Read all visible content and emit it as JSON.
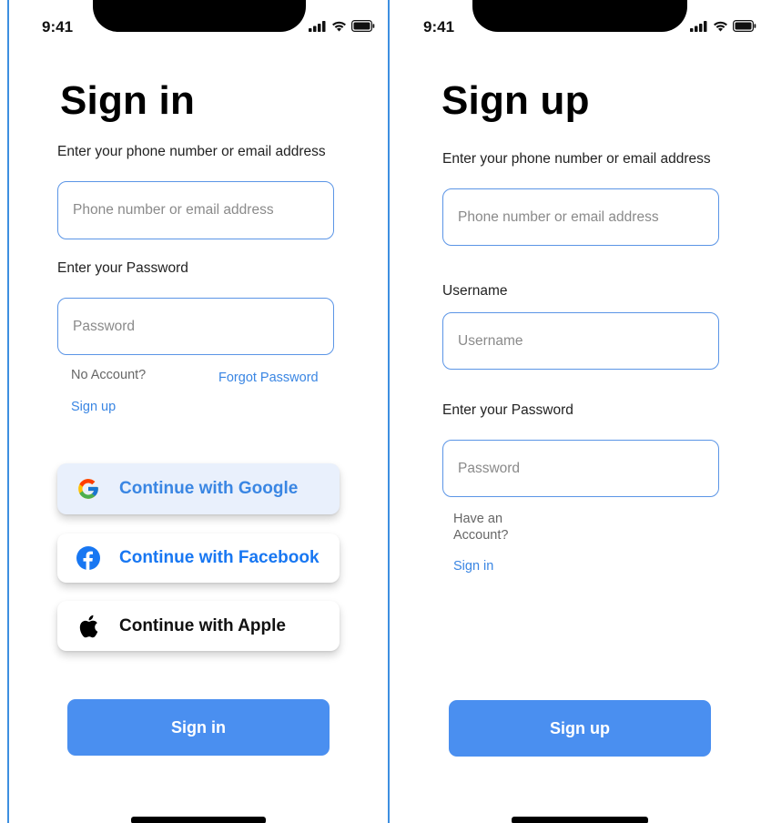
{
  "colors": {
    "accent": "#4a8ff0",
    "link": "#3a86e3",
    "google_bg": "#e9f0fc",
    "google_text": "#3a86e3",
    "facebook_text": "#1877f2"
  },
  "signin": {
    "status_time": "9:41",
    "title": "Sign in",
    "contact_label": "Enter your phone number or email address",
    "contact_placeholder": "Phone number or email address",
    "password_label": "Enter your Password",
    "password_placeholder": "Password",
    "no_account_text": "No Account?",
    "forgot_password": "Forgot Password",
    "signup_link": "Sign up",
    "google_label": "Continue with Google",
    "facebook_label": "Continue with Facebook",
    "apple_label": "Continue with Apple",
    "submit_label": "Sign in"
  },
  "signup": {
    "status_time": "9:41",
    "title": "Sign up",
    "contact_label": "Enter your phone number or email address",
    "contact_placeholder": "Phone number or email address",
    "username_label": "Username",
    "username_placeholder": "Username",
    "password_label": "Enter your Password",
    "password_placeholder": "Password",
    "have_account_line1": "Have an",
    "have_account_line2": "Account?",
    "signin_link": "Sign in",
    "submit_label": "Sign up"
  },
  "icons": {
    "signal": "cellular-signal-icon",
    "wifi": "wifi-icon",
    "battery": "battery-icon",
    "google": "google-icon",
    "facebook": "facebook-icon",
    "apple": "apple-icon"
  }
}
